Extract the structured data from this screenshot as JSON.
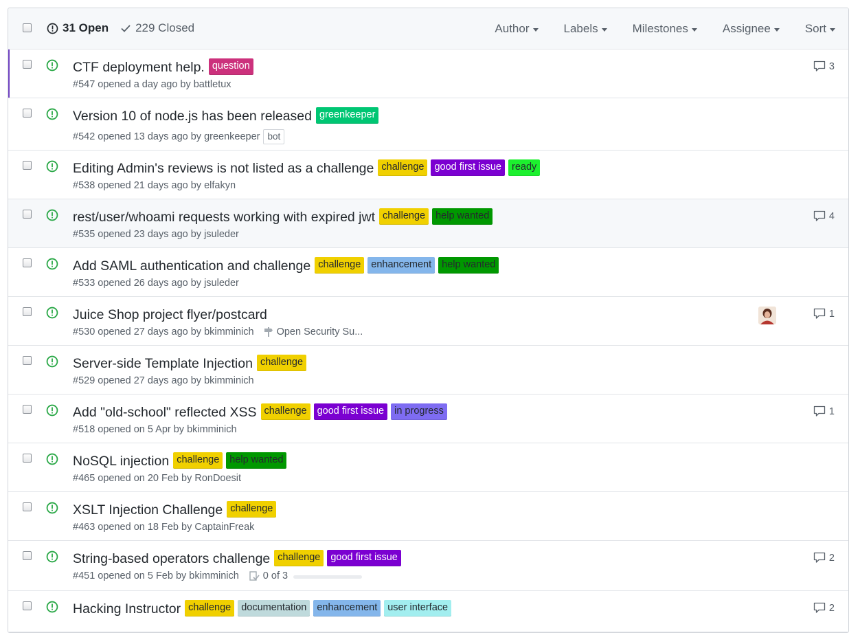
{
  "header": {
    "open_label": "31 Open",
    "closed_label": "229 Closed",
    "filters": [
      "Author",
      "Labels",
      "Milestones",
      "Assignee",
      "Sort"
    ]
  },
  "colors": {
    "open_green": "#28a745",
    "selected_bar": "#6f42c1"
  },
  "issues": [
    {
      "title": "CTF deployment help.",
      "meta": "#547 opened a day ago by ",
      "author": "battletux",
      "labels": [
        {
          "text": "question",
          "bg": "#cc317c",
          "fg": "#ffffff"
        }
      ],
      "comments": "3"
    },
    {
      "title": "Version 10 of node.js has been released",
      "meta": "#542 opened 13 days ago by ",
      "author": "greenkeeper",
      "bot": "bot",
      "labels": [
        {
          "text": "greenkeeper",
          "bg": "#00c673",
          "fg": "#ffffff"
        }
      ],
      "comments": ""
    },
    {
      "title": "Editing Admin's reviews is not listed as a challenge",
      "meta": "#538 opened 21 days ago by ",
      "author": "elfakyn",
      "labels": [
        {
          "text": "challenge",
          "bg": "#f0d000",
          "fg": "#24292e"
        },
        {
          "text": "good first issue",
          "bg": "#7b00d1",
          "fg": "#ffffff"
        },
        {
          "text": "ready",
          "bg": "#1cf02e",
          "fg": "#24292e"
        }
      ],
      "comments": ""
    },
    {
      "title": "rest/user/whoami requests working with expired jwt",
      "meta": "#535 opened 23 days ago by ",
      "author": "jsuleder",
      "labels": [
        {
          "text": "challenge",
          "bg": "#f0d000",
          "fg": "#24292e"
        },
        {
          "text": "help wanted",
          "bg": "#009800",
          "fg": "#24292e"
        }
      ],
      "comments": "4"
    },
    {
      "title": "Add SAML authentication and challenge",
      "meta": "#533 opened 26 days ago by ",
      "author": "jsuleder",
      "labels": [
        {
          "text": "challenge",
          "bg": "#f0d000",
          "fg": "#24292e"
        },
        {
          "text": "enhancement",
          "bg": "#84b6eb",
          "fg": "#24292e"
        },
        {
          "text": "help wanted",
          "bg": "#009800",
          "fg": "#24292e"
        }
      ],
      "comments": ""
    },
    {
      "title": "Juice Shop project flyer/postcard",
      "meta": "#530 opened 27 days ago by ",
      "author": "bkimminich",
      "milestone": "Open Security Su...",
      "avatar": true,
      "labels": [],
      "comments": "1"
    },
    {
      "title": "Server-side Template Injection",
      "meta": "#529 opened 27 days ago by ",
      "author": "bkimminich",
      "labels": [
        {
          "text": "challenge",
          "bg": "#f0d000",
          "fg": "#24292e"
        }
      ],
      "comments": ""
    },
    {
      "title": "Add \"old-school\" reflected XSS",
      "meta": "#518 opened on 5 Apr by ",
      "author": "bkimminich",
      "labels": [
        {
          "text": "challenge",
          "bg": "#f0d000",
          "fg": "#24292e"
        },
        {
          "text": "good first issue",
          "bg": "#7b00d1",
          "fg": "#ffffff"
        },
        {
          "text": "in progress",
          "bg": "#7e6cf2",
          "fg": "#24292e"
        }
      ],
      "comments": "1"
    },
    {
      "title": "NoSQL injection",
      "meta": "#465 opened on 20 Feb by ",
      "author": "RonDoesit",
      "labels": [
        {
          "text": "challenge",
          "bg": "#f0d000",
          "fg": "#24292e"
        },
        {
          "text": "help wanted",
          "bg": "#009800",
          "fg": "#24292e"
        }
      ],
      "comments": ""
    },
    {
      "title": "XSLT Injection Challenge",
      "meta": "#463 opened on 18 Feb by ",
      "author": "CaptainFreak",
      "labels": [
        {
          "text": "challenge",
          "bg": "#f0d000",
          "fg": "#24292e"
        }
      ],
      "comments": ""
    },
    {
      "title": "String-based operators challenge",
      "meta": "#451 opened on 5 Feb by ",
      "author": "bkimminich",
      "tasks": "0 of 3",
      "task_progress": 0,
      "labels": [
        {
          "text": "challenge",
          "bg": "#f0d000",
          "fg": "#24292e"
        },
        {
          "text": "good first issue",
          "bg": "#7b00d1",
          "fg": "#ffffff"
        }
      ],
      "comments": "2"
    },
    {
      "title": "Hacking Instructor",
      "meta": "",
      "author": "",
      "labels": [
        {
          "text": "challenge",
          "bg": "#f0d000",
          "fg": "#24292e"
        },
        {
          "text": "documentation",
          "bg": "#bfdadc",
          "fg": "#24292e"
        },
        {
          "text": "enhancement",
          "bg": "#84b6eb",
          "fg": "#24292e"
        },
        {
          "text": "user interface",
          "bg": "#a2eeef",
          "fg": "#24292e"
        }
      ],
      "comments": "2"
    }
  ]
}
